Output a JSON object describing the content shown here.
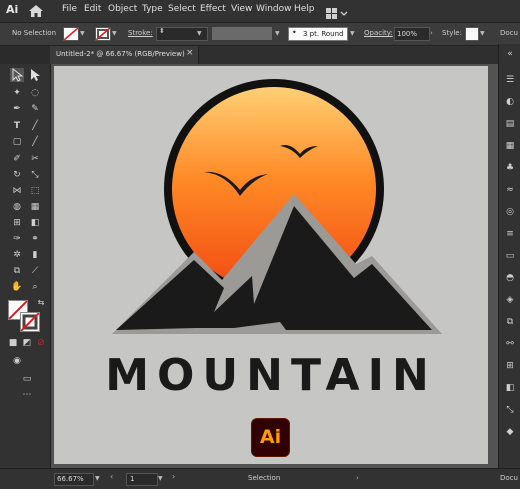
{
  "app": {
    "logo": "Ai",
    "home_icon": "home-icon"
  },
  "menu": [
    "File",
    "Edit",
    "Object",
    "Type",
    "Select",
    "Effect",
    "View",
    "Window",
    "Help"
  ],
  "control_bar": {
    "selection_label": "No Selection",
    "stroke_label": "Stroke:",
    "stroke_profile": "3 pt. Round",
    "opacity_label": "Opacity:",
    "opacity_value": "100%",
    "style_label": "Style:",
    "docu_label": "Docu"
  },
  "document_tab": {
    "title": "Untitled-2* @ 66.67% (RGB/Preview)",
    "close": "×"
  },
  "artwork": {
    "wordmark": "MOUNTAIN",
    "brand_badge": "Ai",
    "sun_gradient": [
      "#ffcf73",
      "#ff6a1a",
      "#f24a12"
    ],
    "mountain_color": "#1a1a1a",
    "outline_color": "#9c9a96"
  },
  "status_bar": {
    "zoom": "66.67%",
    "artboard": "1",
    "mode": "Selection",
    "docu": "Docu"
  },
  "colors": {
    "accent": "#ff9a00",
    "ui_dark": "#323232",
    "artboard_bg": "#c6c7c4"
  }
}
